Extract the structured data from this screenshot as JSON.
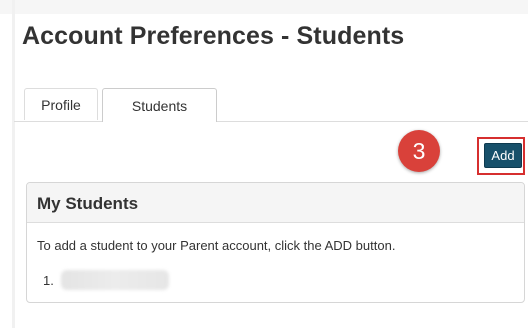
{
  "page": {
    "title": "Account Preferences - Students"
  },
  "tabs": [
    {
      "label": "Profile",
      "active": false
    },
    {
      "label": "Students",
      "active": true
    }
  ],
  "annotation": {
    "step_number": "3",
    "color": "#d9413a"
  },
  "toolbar": {
    "add_label": "Add",
    "add_color": "#17506a"
  },
  "panel": {
    "title": "My Students",
    "instruction": "To add a student to your Parent account, click the ADD button.",
    "students": [
      {
        "number": "1.",
        "name": ""
      }
    ]
  }
}
